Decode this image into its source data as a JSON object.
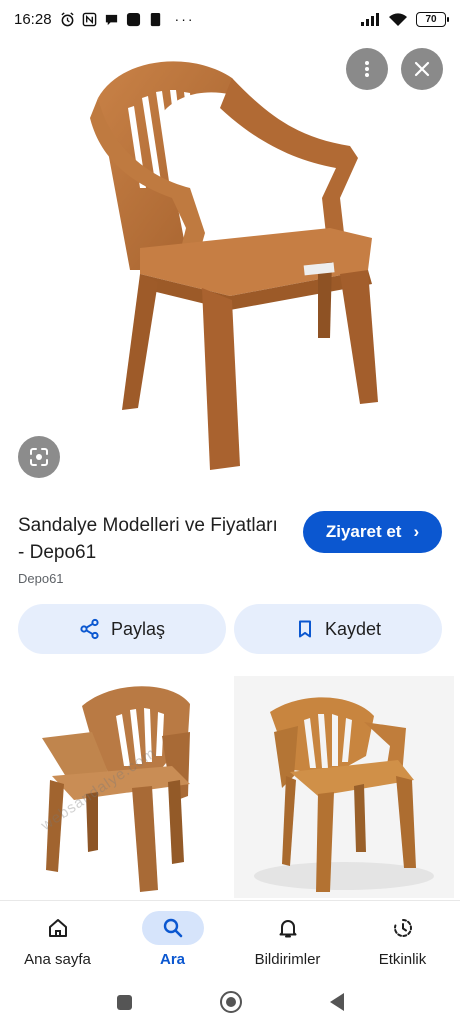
{
  "status_bar": {
    "time": "16:28",
    "battery": "70",
    "icons": [
      "alarm-icon",
      "nfc-icon",
      "chat-icon",
      "app-icon",
      "sim-icon",
      "more-dots",
      "signal-icon",
      "wifi-icon",
      "battery-icon"
    ],
    "dots": "···"
  },
  "hero": {
    "more_icon": "more-vertical-icon",
    "close_icon": "close-icon",
    "lens_icon": "lens-icon"
  },
  "result": {
    "title": "Sandalye Modelleri ve Fiyatları - Depo61",
    "source": "Depo61",
    "visit_label": "Ziyaret et",
    "visit_chevron": "›"
  },
  "actions": {
    "share_label": "Paylaş",
    "save_label": "Kaydet"
  },
  "related": {
    "watermark": "websandalye.com"
  },
  "bottom_nav": {
    "items": [
      {
        "label": "Ana sayfa",
        "icon": "home-icon"
      },
      {
        "label": "Ara",
        "icon": "search-icon"
      },
      {
        "label": "Bildirimler",
        "icon": "bell-icon"
      },
      {
        "label": "Etkinlik",
        "icon": "activity-icon"
      }
    ],
    "active_index": 1
  },
  "colors": {
    "accent": "#0b57d0",
    "pill_bg": "#e6eefc",
    "chair": "#b8713a"
  }
}
